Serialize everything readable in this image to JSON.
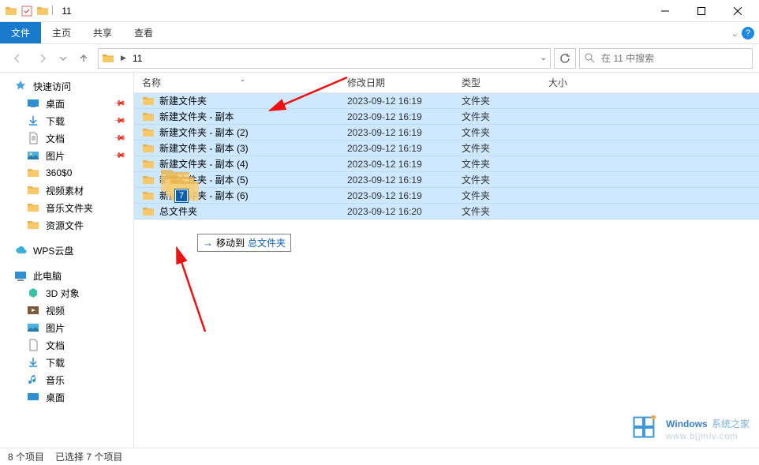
{
  "titlebar": {
    "title": "11"
  },
  "ribbon": {
    "file": "文件",
    "tabs": [
      "主页",
      "共享",
      "查看"
    ]
  },
  "navbar": {
    "path_label": "11",
    "search_placeholder": "在 11 中搜索"
  },
  "sidebar": {
    "quick_access": "快速访问",
    "pinned": [
      {
        "label": "桌面",
        "icon": "desktop"
      },
      {
        "label": "下载",
        "icon": "download"
      },
      {
        "label": "文档",
        "icon": "document"
      },
      {
        "label": "图片",
        "icon": "picture"
      }
    ],
    "recent": [
      {
        "label": "360$0"
      },
      {
        "label": "视频素材"
      },
      {
        "label": "音乐文件夹"
      },
      {
        "label": "资源文件"
      }
    ],
    "wps": "WPS云盘",
    "this_pc": "此电脑",
    "pc_items": [
      {
        "label": "3D 对象",
        "icon": "3d"
      },
      {
        "label": "视频",
        "icon": "video"
      },
      {
        "label": "图片",
        "icon": "picture"
      },
      {
        "label": "文档",
        "icon": "document"
      },
      {
        "label": "下载",
        "icon": "download"
      },
      {
        "label": "音乐",
        "icon": "music"
      },
      {
        "label": "桌面",
        "icon": "desktop"
      }
    ]
  },
  "columns": {
    "name": "名称",
    "date": "修改日期",
    "type": "类型",
    "size": "大小"
  },
  "files": [
    {
      "name": "新建文件夹",
      "date": "2023-09-12 16:19",
      "type": "文件夹"
    },
    {
      "name": "新建文件夹 - 副本",
      "date": "2023-09-12 16:19",
      "type": "文件夹"
    },
    {
      "name": "新建文件夹 - 副本 (2)",
      "date": "2023-09-12 16:19",
      "type": "文件夹"
    },
    {
      "name": "新建文件夹 - 副本 (3)",
      "date": "2023-09-12 16:19",
      "type": "文件夹"
    },
    {
      "name": "新建文件夹 - 副本 (4)",
      "date": "2023-09-12 16:19",
      "type": "文件夹"
    },
    {
      "name": "新建文件夹 - 副本 (5)",
      "date": "2023-09-12 16:19",
      "type": "文件夹"
    },
    {
      "name": "新建文件夹 - 副本 (6)",
      "date": "2023-09-12 16:19",
      "type": "文件夹"
    },
    {
      "name": "总文件夹",
      "date": "2023-09-12 16:20",
      "type": "文件夹"
    }
  ],
  "drag": {
    "count": "7",
    "tip_prefix": "移动到",
    "tip_target": "总文件夹"
  },
  "status": {
    "items": "8 个项目",
    "selected": "已选择 7 个项目"
  },
  "watermark": {
    "brand1": "Windows",
    "brand2": "系统之家",
    "url": "www.bjjmlv.com"
  }
}
